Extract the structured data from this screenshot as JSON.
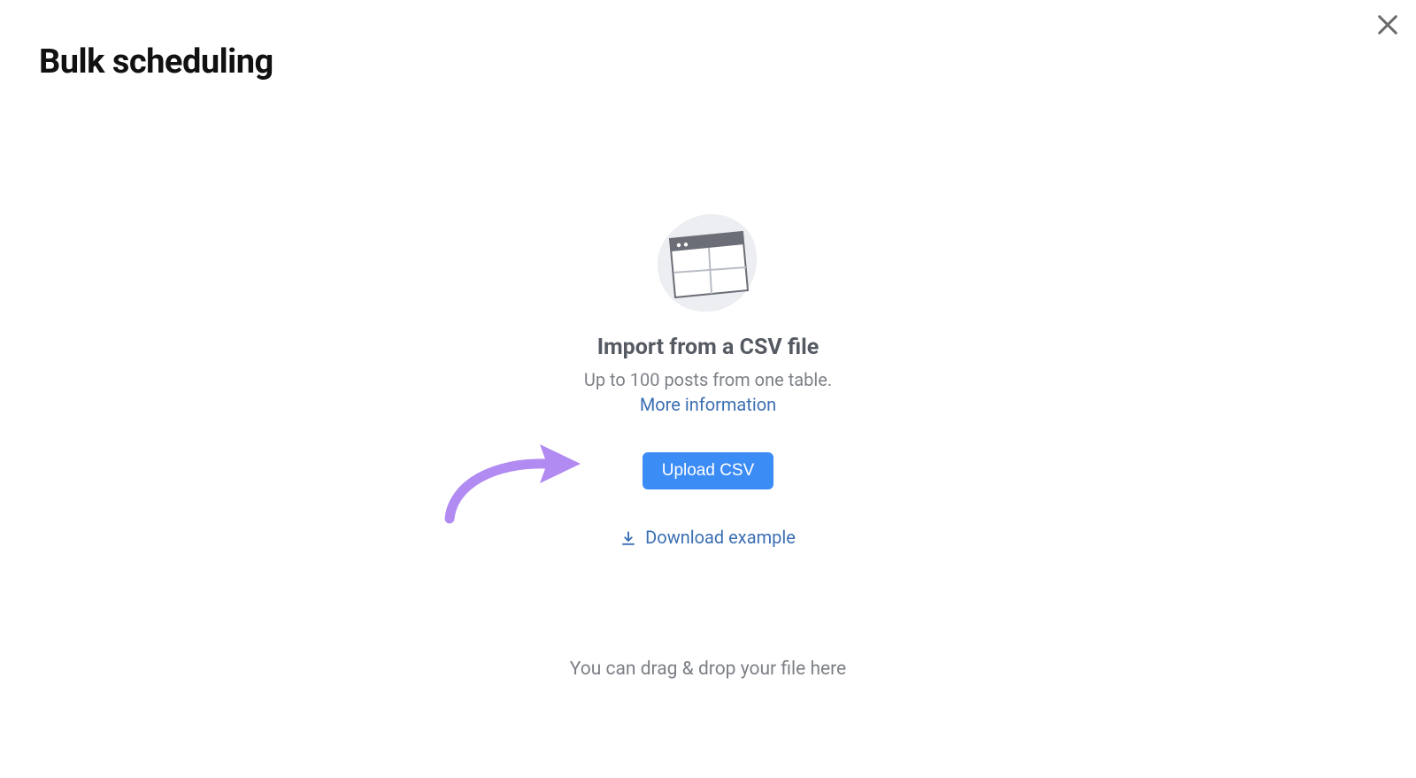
{
  "title": "Bulk scheduling",
  "import": {
    "heading": "Import from a CSV file",
    "subtext": "Up to 100 posts from one table.",
    "more_info": "More information",
    "upload_label": "Upload CSV",
    "download_label": "Download example"
  },
  "footer": "You can drag & drop your file here"
}
